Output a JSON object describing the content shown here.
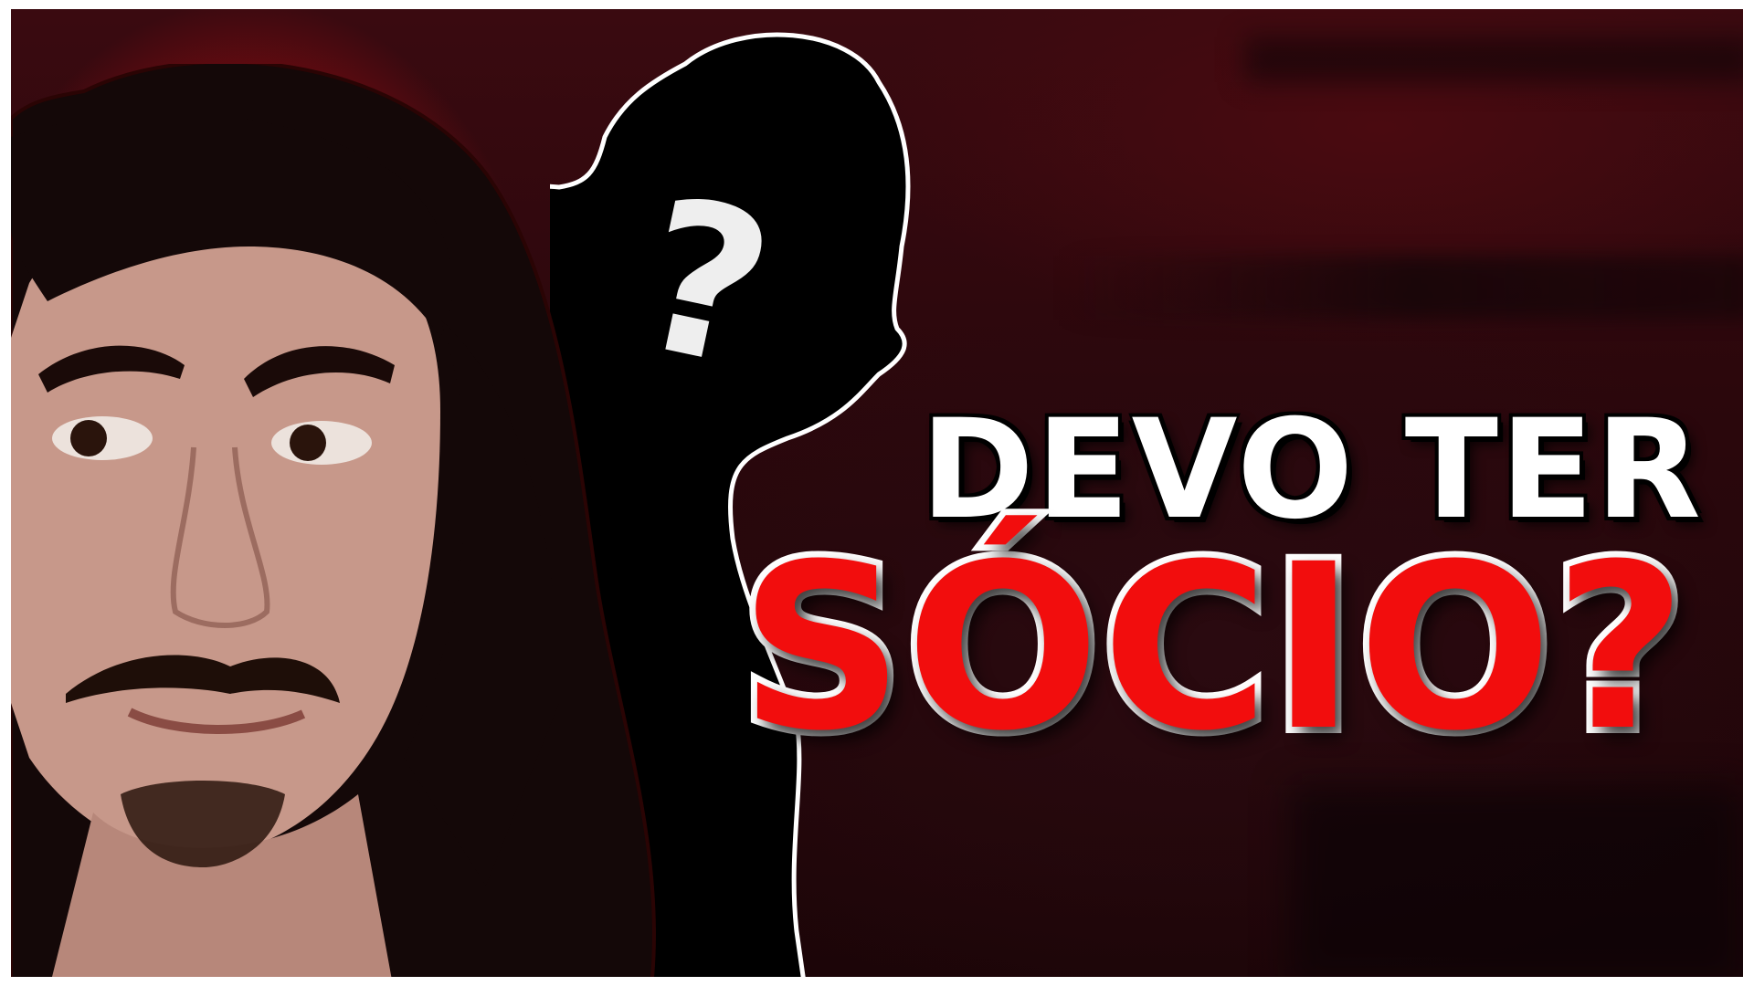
{
  "thumbnail": {
    "headline_line1": "DEVO TER",
    "headline_line2": "SÓCIO?",
    "silhouette_mark": "?",
    "colors": {
      "accent_red": "#f20d0d",
      "headline_white": "#ffffff",
      "silhouette_black": "#000000",
      "background_dark_red": "#2b070c"
    },
    "icons": {
      "silhouette": "mystery-person-silhouette-icon",
      "question": "question-mark-icon"
    }
  }
}
